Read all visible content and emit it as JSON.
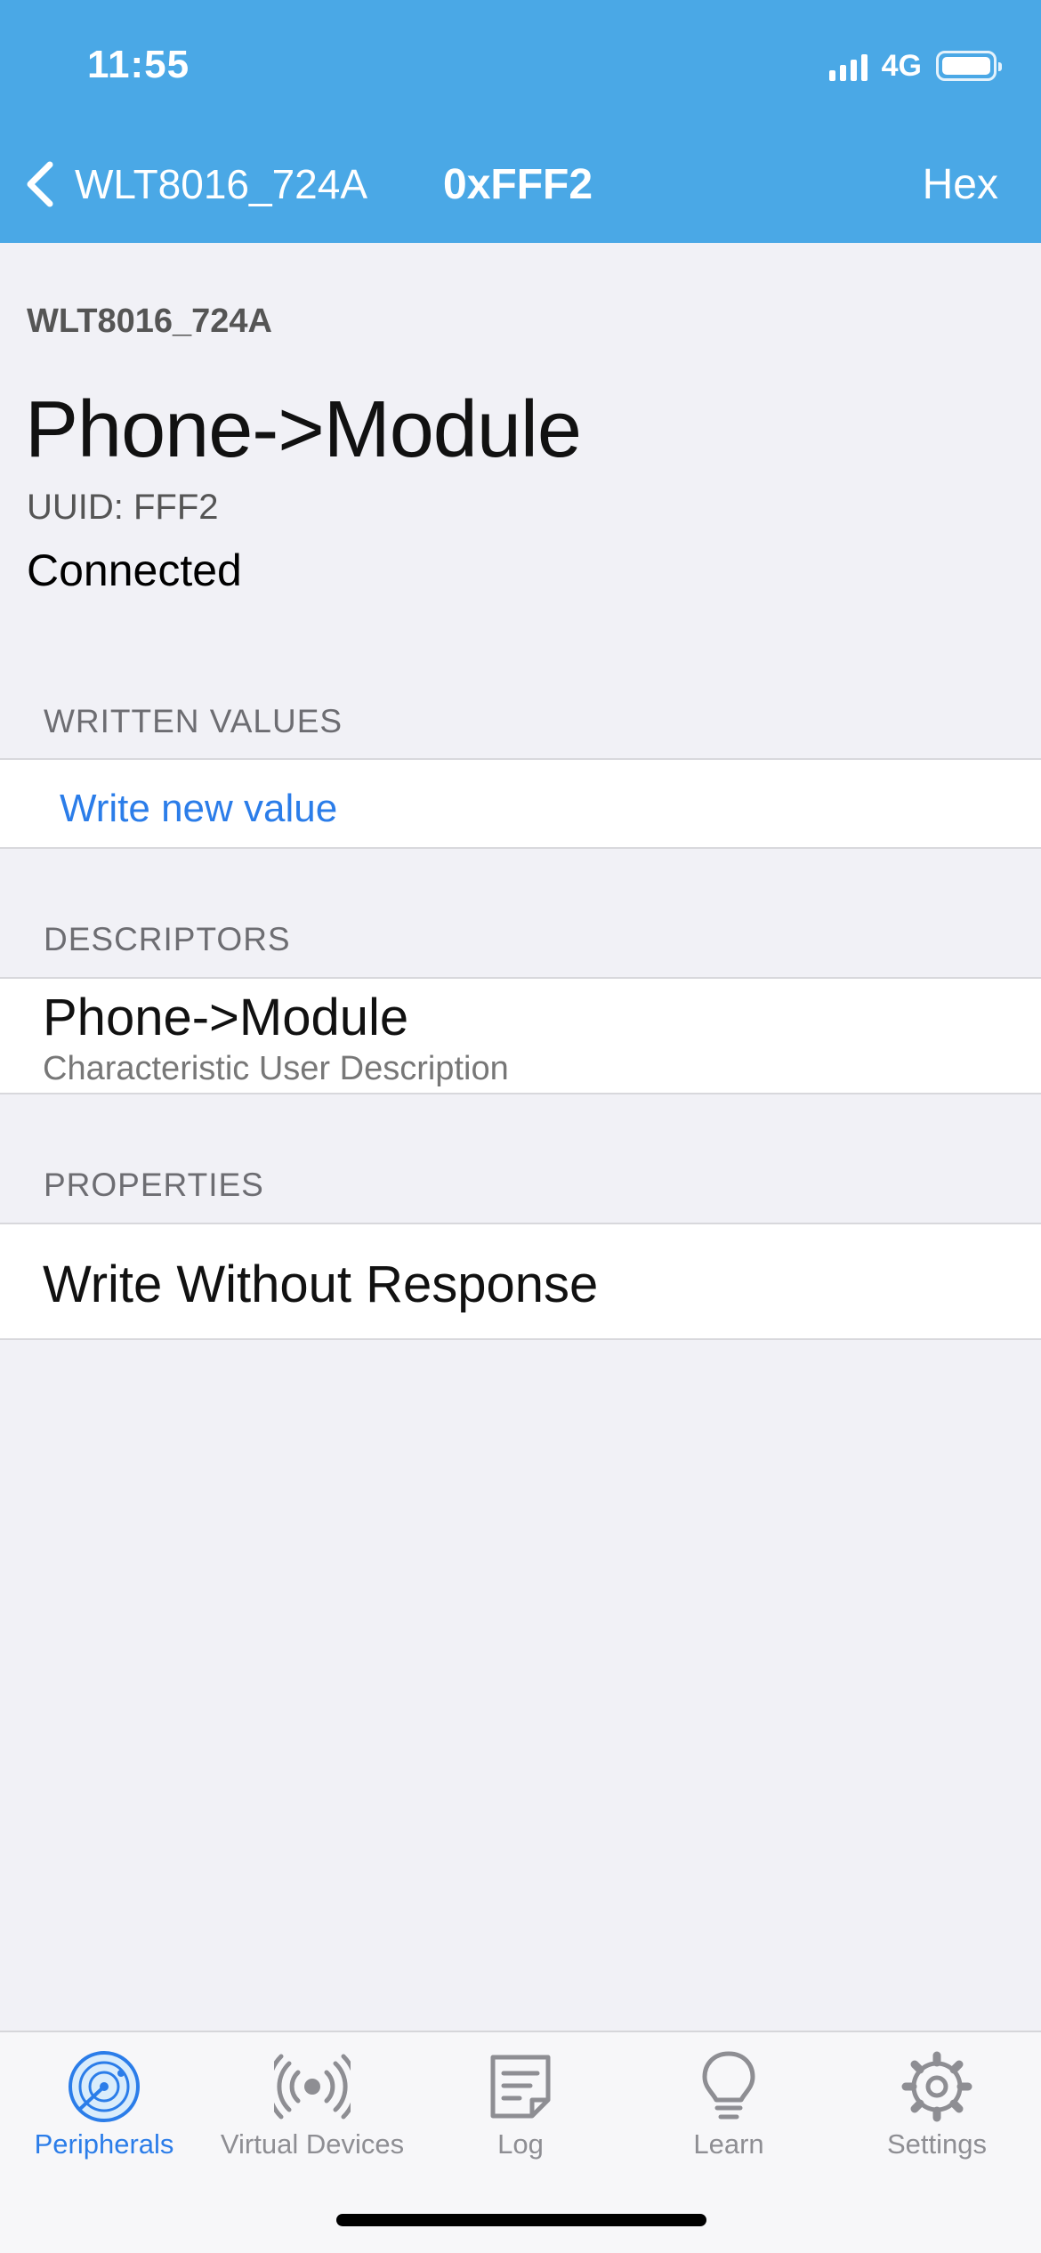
{
  "status_bar": {
    "time": "11:55",
    "network": "4G",
    "battery_level": 1.0
  },
  "nav": {
    "back_label": "WLT8016_724A",
    "title": "0xFFF2",
    "right_button": "Hex"
  },
  "header": {
    "device_name": "WLT8016_724A",
    "characteristic_name": "Phone->Module",
    "uuid": "UUID: FFF2",
    "connection_status": "Connected"
  },
  "written_values": {
    "header": "WRITTEN VALUES",
    "action_label": "Write new value"
  },
  "descriptors": {
    "header": "DESCRIPTORS",
    "items": [
      {
        "title": "Phone->Module",
        "subtitle": "Characteristic User Description"
      }
    ]
  },
  "properties": {
    "header": "PROPERTIES",
    "items": [
      "Write Without Response"
    ]
  },
  "tabbar": {
    "tabs": [
      {
        "label": "Peripherals",
        "icon": "radar-icon",
        "active": true
      },
      {
        "label": "Virtual Devices",
        "icon": "broadcast-icon",
        "active": false
      },
      {
        "label": "Log",
        "icon": "note-icon",
        "active": false
      },
      {
        "label": "Learn",
        "icon": "lightbulb-icon",
        "active": false
      },
      {
        "label": "Settings",
        "icon": "gear-icon",
        "active": false
      }
    ]
  },
  "colors": {
    "nav_background": "#4aa8e6",
    "accent": "#2b7de9",
    "page_background": "#f1f1f6",
    "inactive_tab": "#8e8e93"
  }
}
